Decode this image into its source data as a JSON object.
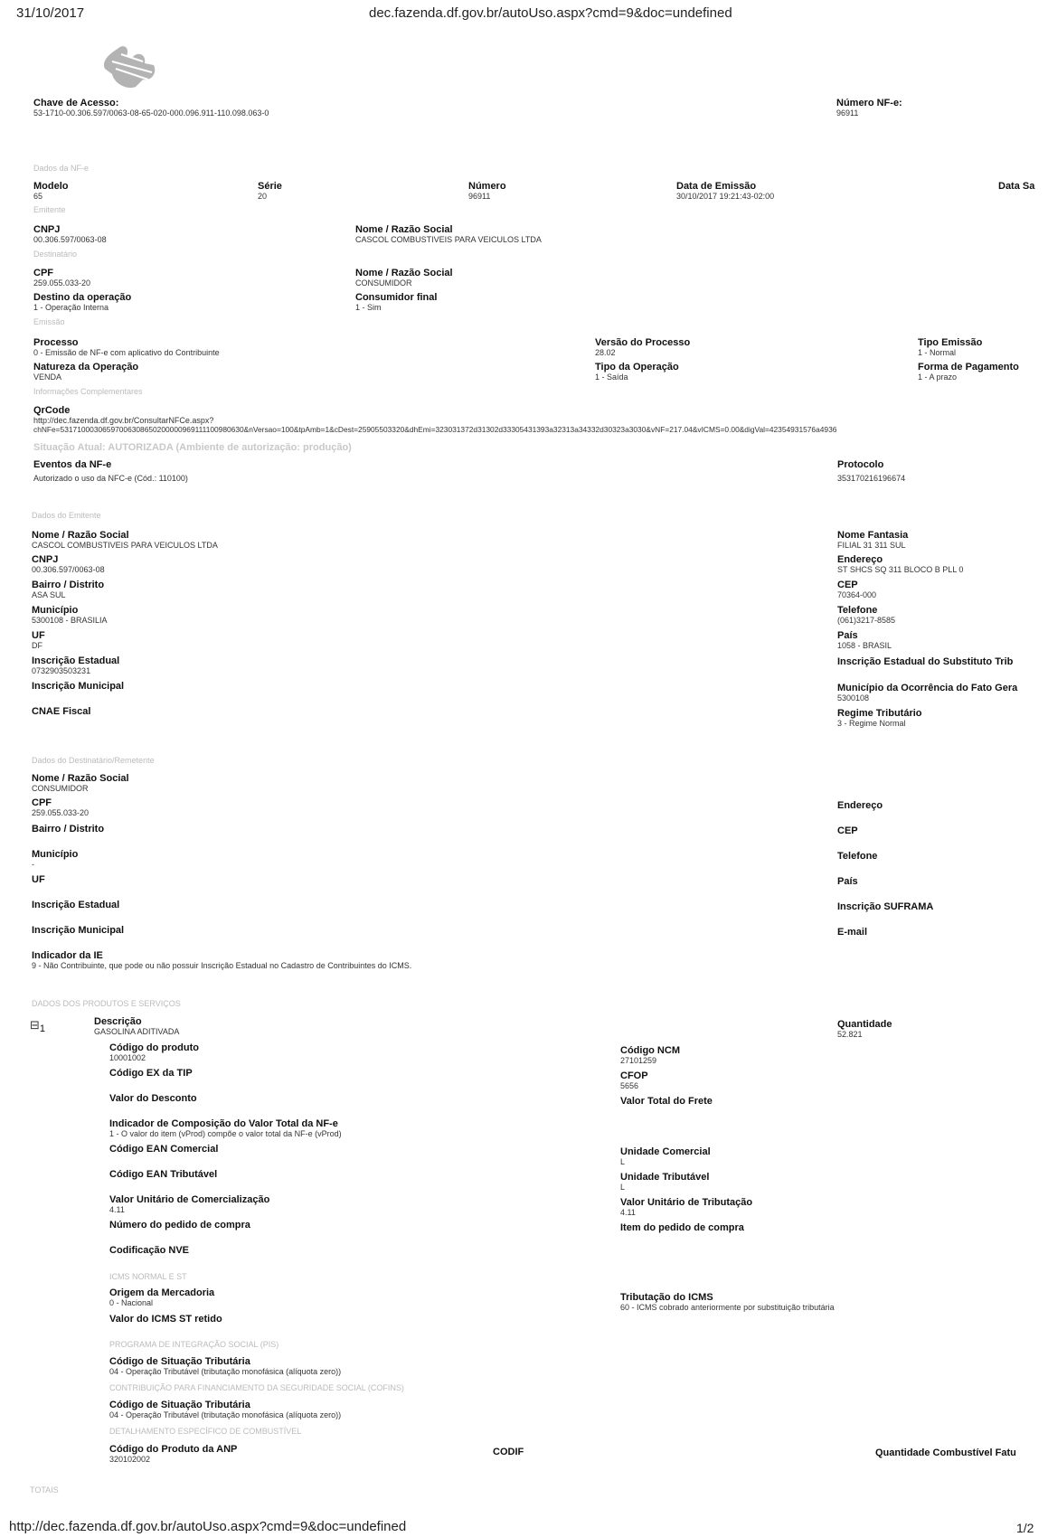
{
  "browser": {
    "date": "31/10/2017",
    "url_top": "dec.fazenda.df.gov.br/autoUso.aspx?cmd=9&doc=undefined",
    "url_bottom": "http://dec.fazenda.df.gov.br/autoUso.aspx?cmd=9&doc=undefined",
    "page": "1/2"
  },
  "header": {
    "chave_label": "Chave de Acesso:",
    "chave_value": "53-1710-00.306.597/0063-08-65-020-000.096.911-110.098.063-0",
    "numero_label": "Número NF-e:",
    "numero_value": "96911"
  },
  "dados_nfe": {
    "section": "Dados da NF-e",
    "modelo_label": "Modelo",
    "modelo": "65",
    "serie_label": "Série",
    "serie": "20",
    "numero_label": "Número",
    "numero": "96911",
    "data_emissao_label": "Data de Emissão",
    "data_emissao": "30/10/2017 19:21:43-02:00",
    "data_saida_label": "Data Sa",
    "emitente_section": "Emitente",
    "cnpj_label": "CNPJ",
    "cnpj": "00.306.597/0063-08",
    "nome_label": "Nome / Razão Social",
    "nome": "CASCOL COMBUSTIVEIS PARA VEICULOS LTDA",
    "dest_section": "Destinatário",
    "cpf_label": "CPF",
    "cpf": "259.055.033-20",
    "dest_nome_label": "Nome / Razão Social",
    "dest_nome": "CONSUMIDOR",
    "destino_label": "Destino da operação",
    "destino": "1 - Operação Interna",
    "consumidor_label": "Consumidor final",
    "consumidor": "1 - Sim",
    "emissao_section": "Emissão",
    "processo_label": "Processo",
    "processo": "0 - Emissão de NF-e com aplicativo do Contribuinte",
    "versao_label": "Versão do Processo",
    "versao": "28.02",
    "tipo_emissao_label": "Tipo Emissão",
    "tipo_emissao": "1 - Normal",
    "natureza_label": "Natureza da Operação",
    "natureza": "VENDA",
    "tipo_operacao_label": "Tipo da Operação",
    "tipo_operacao": "1 - Saída",
    "forma_pagamento_label": "Forma de Pagamento",
    "forma_pagamento": "1 - A prazo",
    "info_section": "Informações Complementares",
    "qrcode_label": "QrCode",
    "qrcode_line1": "http://dec.fazenda.df.gov.br/ConsultarNFCe.aspx?",
    "qrcode_line2": "chNFe=53171000306597006308650200000969111100980630&nVersao=100&tpAmb=1&cDest=25905503320&dhEmi=323031372d31302d33305431393a32313a34332d30323a3030&vNF=217.04&vICMS=0.00&digVal=42354931576a4936",
    "situacao": "Situação Atual: AUTORIZADA (Ambiente de autorização: produção)",
    "eventos_label": "Eventos da NF-e",
    "eventos": "Autorizado o uso da NFC-e (Cód.: 110100)",
    "protocolo_label": "Protocolo",
    "protocolo": "353170216196674"
  },
  "emitente": {
    "section": "Dados do Emitente",
    "nome_label": "Nome / Razão Social",
    "nome": "CASCOL COMBUSTIVEIS PARA VEICULOS LTDA",
    "fantasia_label": "Nome Fantasia",
    "fantasia": "FILIAL 31 311 SUL",
    "cnpj_label": "CNPJ",
    "cnpj": "00.306.597/0063-08",
    "endereco_label": "Endereço",
    "endereco": "ST SHCS SQ 311 BLOCO B PLL 0",
    "bairro_label": "Bairro / Distrito",
    "bairro": "ASA SUL",
    "cep_label": "CEP",
    "cep": "70364-000",
    "municipio_label": "Município",
    "municipio": "5300108 - BRASILIA",
    "telefone_label": "Telefone",
    "telefone": "(061)3217-8585",
    "uf_label": "UF",
    "uf": "DF",
    "pais_label": "País",
    "pais": "1058 - BRASIL",
    "ie_label": "Inscrição Estadual",
    "ie": "0732903503231",
    "ie_st_label": "Inscrição Estadual do Substituto Trib",
    "im_label": "Inscrição Municipal",
    "mun_fato_label": "Município da Ocorrência do Fato Gera",
    "mun_fato": "5300108",
    "cnae_label": "CNAE Fiscal",
    "regime_label": "Regime Tributário",
    "regime": "3 - Regime Normal"
  },
  "destinatario": {
    "section": "Dados do Destinatário/Remetente",
    "nome_label": "Nome / Razão Social",
    "nome": "CONSUMIDOR",
    "cpf_label": "CPF",
    "cpf": "259.055.033-20",
    "endereco_label": "Endereço",
    "bairro_label": "Bairro / Distrito",
    "cep_label": "CEP",
    "municipio_label": "Município",
    "municipio": "-",
    "telefone_label": "Telefone",
    "uf_label": "UF",
    "pais_label": "País",
    "ie_label": "Inscrição Estadual",
    "suframa_label": "Inscrição SUFRAMA",
    "im_label": "Inscrição Municipal",
    "email_label": "E-mail",
    "ind_ie_label": "Indicador da IE",
    "ind_ie": "9 - Não Contribuinte, que pode ou não possuir Inscrição Estadual no Cadastro de Contribuintes do ICMS."
  },
  "produtos": {
    "section": "DADOS DOS PRODUTOS E SERVIÇOS",
    "toggle": "⊟",
    "item_num": "1",
    "descricao_label": "Descrição",
    "descricao": "GASOLINA ADITIVADA",
    "quantidade_label": "Quantidade",
    "quantidade": "52.821",
    "codigo_label": "Código do produto",
    "codigo": "10001002",
    "ncm_label": "Código NCM",
    "ncm": "27101259",
    "ex_tip_label": "Código EX da TIP",
    "cfop_label": "CFOP",
    "cfop": "5656",
    "desconto_label": "Valor do Desconto",
    "frete_label": "Valor Total do Frete",
    "indicador_label": "Indicador de Composição do Valor Total da NF-e",
    "indicador": "1 - O valor do item (vProd) compõe o valor total da NF-e (vProd)",
    "ean_com_label": "Código EAN Comercial",
    "un_com_label": "Unidade Comercial",
    "un_com": "L",
    "ean_trib_label": "Código EAN Tributável",
    "un_trib_label": "Unidade Tributável",
    "un_trib": "L",
    "vun_com_label": "Valor Unitário de Comercialização",
    "vun_com": "4.11",
    "vun_trib_label": "Valor Unitário de Tributação",
    "vun_trib": "4.11",
    "pedido_label": "Número do pedido de compra",
    "item_pedido_label": "Item do pedido de compra",
    "nve_label": "Codificação NVE",
    "icms_section": "ICMS NORMAL E ST",
    "origem_label": "Origem da Mercadoria",
    "origem": "0 - Nacional",
    "trib_icms_label": "Tributação do ICMS",
    "trib_icms": "60 - ICMS cobrado anteriormente por substituição tributária",
    "icms_st_label": "Valor do ICMS ST retido",
    "pis_section": "PROGRAMA DE INTEGRAÇÃO SOCIAL (PIS)",
    "cst_pis_label": "Código de Situação Tributária",
    "cst_pis": "04 - Operação Tributável (tributação monofásica (alíquota zero))",
    "cofins_section": "CONTRIBUIÇÃO PARA FINANCIAMENTO DA SEGURIDADE SOCIAL (COFINS)",
    "cst_cofins_label": "Código de Situação Tributária",
    "cst_cofins": "04 - Operação Tributável (tributação monofásica (alíquota zero))",
    "comb_section": "DETALHAMENTO ESPECÍFICO DE COMBUSTÍVEL",
    "anp_label": "Código do Produto da ANP",
    "anp": "320102002",
    "codif_label": "CODIF",
    "qtd_comb_label": "Quantidade Combustível Fatu"
  },
  "totais": {
    "section": "TOTAIS"
  }
}
